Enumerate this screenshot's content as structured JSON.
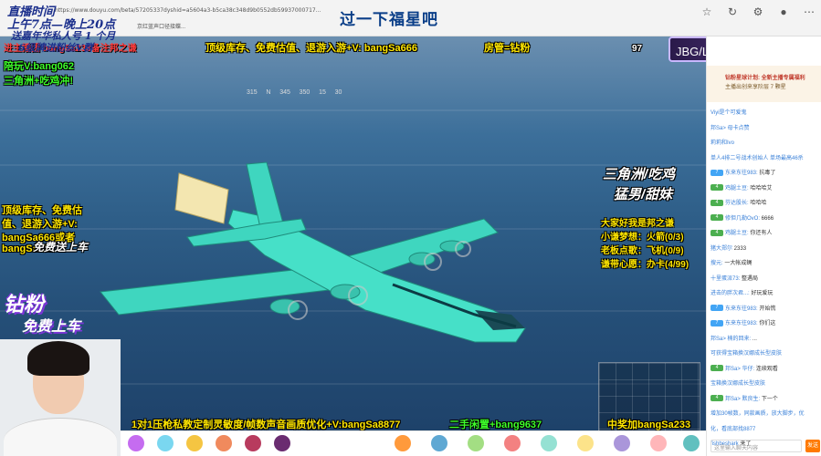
{
  "browser": {
    "url": "https://www.douyu.com/beta/57205337dyshid=a5604a3-b5ca38c348d9b0552db59937000717...",
    "tab_text": "京红蓝声口径接蝶..."
  },
  "stream": {
    "header_title": "过一下福星吧",
    "top_left_lines": [
      "直播时间",
      "上午7点—晚上20点",
      "送嘉年华私人号 1 个月",
      "6级牌进粉丝V群",
      "陪玩V:bang062",
      "三角洲+吃鸡冲!"
    ],
    "gift_notice": "进主播团 bangSa233备注邦之谦",
    "top_mid": "顶级库存、免费估值、退游入游+V: bangSa666",
    "top_mid_tag": "房管=钻粉",
    "compass_values": [
      "315",
      "N",
      "345",
      "350",
      "15",
      "30"
    ],
    "jbg_label": "JBG/LG|U 欢迎各位",
    "left_promo": [
      "顶级库存、免费估",
      "值、退游入游+V:",
      "bangSa666或者",
      "bangSa232"
    ],
    "left_promo_sub": "免费送上车",
    "diamond_badge_1": "钻粉",
    "diamond_badge_2": "免费上车",
    "right_tagline_1": "三角洲/吃鸡",
    "right_tagline_2": "猛男/甜妹",
    "right_list": [
      "大家好我是邦之谦",
      "小谦梦想：火箭(0/3)",
      "老板点歌：飞机(0/9)",
      "谦带心愿：办卡(4/99)"
    ],
    "bottom_banner": "1对1压枪私教定制灵敏度/帧数声音画质优化+V:bangSa8877",
    "bottom_banner_2": "二手闲置+bang9637",
    "bottom_right": "中奖加bangSa233",
    "game_score": "97"
  },
  "chat": {
    "banner_title": "钻粉星球计划: 全新主播专属福利",
    "banner_sub": "主播出创来享阶层 7 颗星",
    "messages": [
      {
        "lvl": "",
        "name": "Viyi是个可爱鬼",
        "text": ""
      },
      {
        "lvl": "",
        "name": "邦Sa> 母卡点赞",
        "text": ""
      },
      {
        "lvl": "",
        "name": "莉莉和Ivo",
        "text": ""
      },
      {
        "lvl": "",
        "name": "单人4排二号战术创始人 单场最高46杀",
        "text": ""
      },
      {
        "lvl": "7",
        "name": "东来东往983:",
        "text": "抗毒了"
      },
      {
        "lvl": "4",
        "name": "鸡腿土豆:",
        "text": "哈哈哈艾"
      },
      {
        "lvl": "4",
        "name": "芬达股长:",
        "text": "哈哈哈"
      },
      {
        "lvl": "4",
        "name": "修但几勒OvO:",
        "text": "6666"
      },
      {
        "lvl": "4",
        "name": "鸡腿土豆:",
        "text": "你还有人"
      },
      {
        "lvl": "",
        "name": "猪大郑尔",
        "text": "2333"
      },
      {
        "lvl": "",
        "name": "搜元:",
        "text": "一大帐成蝇"
      },
      {
        "lvl": "",
        "name": "十里蛋派73:",
        "text": "整遇局"
      },
      {
        "lvl": "",
        "name": "进击的胖次君...:",
        "text": "好玩爱玩"
      },
      {
        "lvl": "7",
        "name": "东来东往983:",
        "text": "开始慌"
      },
      {
        "lvl": "7",
        "name": "东来东往983:",
        "text": "你们这"
      },
      {
        "lvl": "",
        "name": "邦Sa> 楠的回来:",
        "text": "..."
      },
      {
        "lvl": "",
        "name": "可获得宝箱换汉娜成长型皮肤",
        "text": ""
      },
      {
        "lvl": "4",
        "name": "邦Sa> 华仔:",
        "text": "连续观看"
      },
      {
        "lvl": "",
        "name": "宝箱换汉娜成长型皮肤",
        "text": ""
      },
      {
        "lvl": "4",
        "name": "邦Sa> 默良生:",
        "text": "下一个"
      },
      {
        "lvl": "",
        "name": "增加30帧数，同款画质，放大脚步，优",
        "text": ""
      },
      {
        "lvl": "",
        "name": "化，看底部找8877",
        "text": ""
      },
      {
        "lvl": "",
        "name": "fishbeshark",
        "text": "来了"
      }
    ],
    "input_placeholder": "这里输入聊天内容",
    "send_label": "发送"
  },
  "colors": {
    "sea": "#2f5f89",
    "plane": "#3fd6bf",
    "accent": "#ff7a00"
  }
}
